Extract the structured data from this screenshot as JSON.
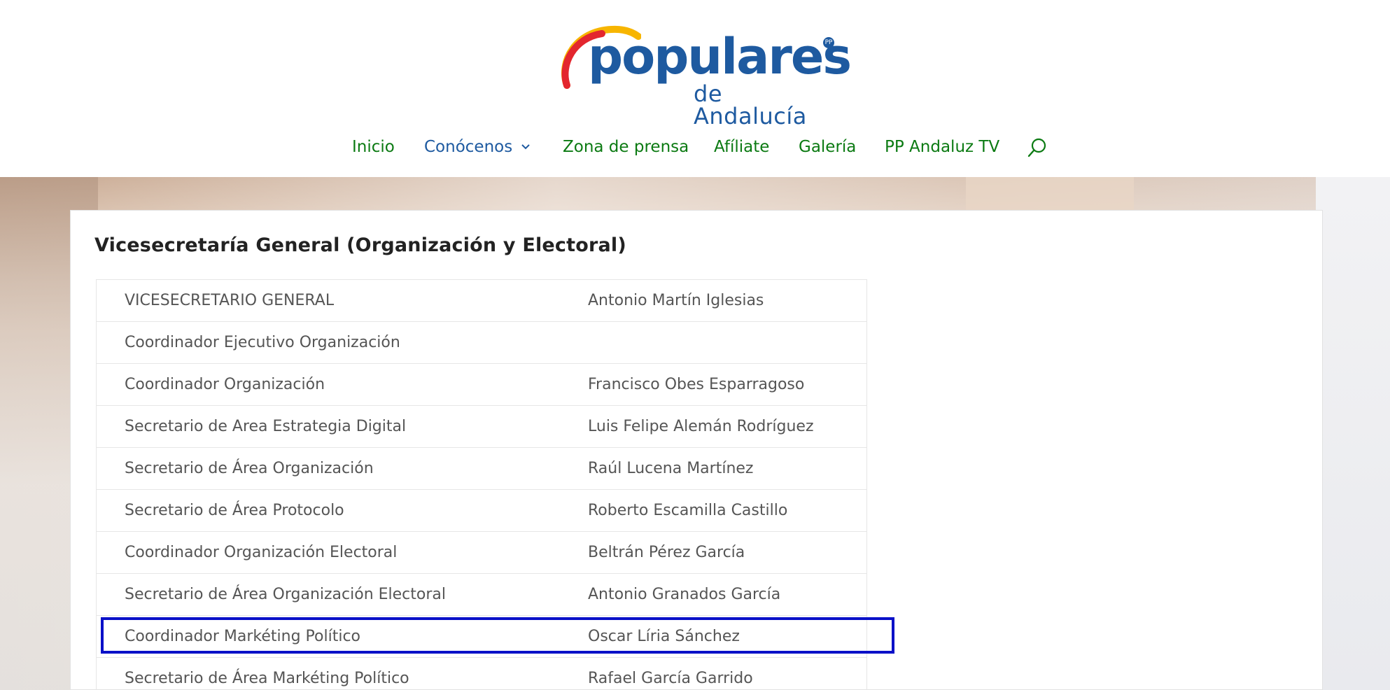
{
  "logo": {
    "wordmark": "populares",
    "subtitle": "de Andalucía",
    "brand_color": "#1e5aa0",
    "arc_colors": [
      "#e3262e",
      "#f7b500"
    ]
  },
  "nav": {
    "items": [
      {
        "label": "Inicio"
      },
      {
        "label": "Conócenos"
      },
      {
        "label": "Zona de prensa"
      },
      {
        "label": "Afíliate"
      },
      {
        "label": "Galería"
      },
      {
        "label": "PP Andaluz TV"
      }
    ],
    "active_index": 1,
    "link_color": "#0b7a12",
    "active_color": "#1e5aa0",
    "search_icon": "search-icon"
  },
  "section": {
    "title": "Vicesecretaría General (Organización y Electoral)"
  },
  "table": {
    "rows": [
      {
        "role": "VICESECRETARIO GENERAL",
        "name": "Antonio Martín Iglesias"
      },
      {
        "role": "Coordinador Ejecutivo Organización",
        "name": ""
      },
      {
        "role": "Coordinador Organización",
        "name": "Francisco Obes Esparragoso"
      },
      {
        "role": "Secretario de Area  Estrategia Digital",
        "name": "Luis Felipe Alemán Rodríguez"
      },
      {
        "role": "Secretario de Área Organización",
        "name": "Raúl Lucena Martínez"
      },
      {
        "role": "Secretario de Área Protocolo",
        "name": "Roberto Escamilla Castillo"
      },
      {
        "role": "Coordinador Organización Electoral",
        "name": "Beltrán Pérez García"
      },
      {
        "role": "Secretario de Área Organización Electoral",
        "name": "Antonio Granados García"
      },
      {
        "role": "Coordinador Markéting Político",
        "name": "Oscar Líria Sánchez"
      },
      {
        "role": "Secretario de Área Markéting Político",
        "name": "Rafael García Garrido"
      }
    ],
    "highlighted_row_index": 8,
    "highlight_color": "#0a10c8"
  }
}
